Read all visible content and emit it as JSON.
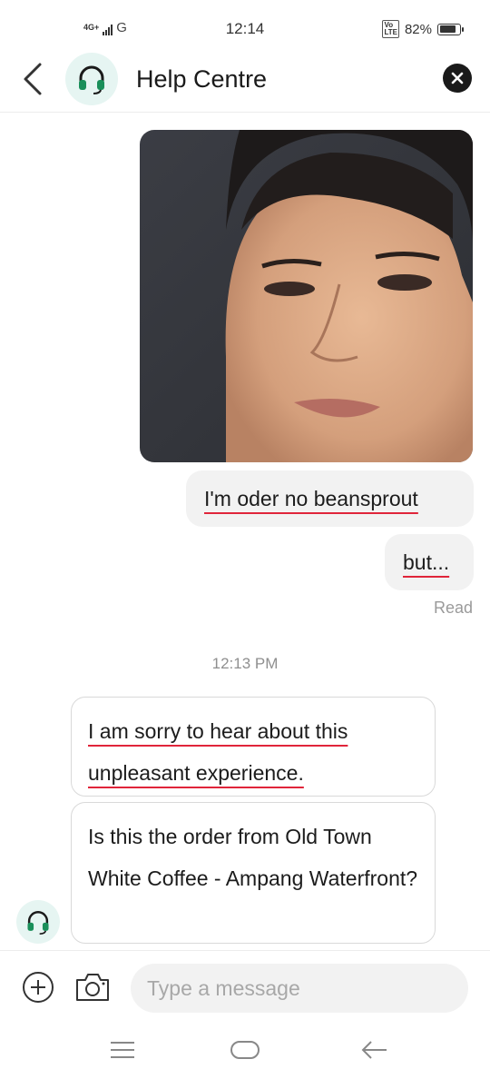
{
  "status_bar": {
    "network": "4G+",
    "carrier_icon": "G",
    "time": "12:14",
    "volte": "VoLTE",
    "battery_text": "82%",
    "battery_level": 0.82
  },
  "header": {
    "title": "Help Centre",
    "back_icon": "chevron-left-icon",
    "avatar_icon": "headset-icon",
    "close_icon": "close-icon"
  },
  "messages": {
    "outgoing": [
      {
        "type": "image",
        "description_icon": "photo-message"
      },
      {
        "type": "text",
        "text": "I'm oder no beansprout"
      },
      {
        "type": "text",
        "text": "but..."
      }
    ],
    "read_receipt": "Read",
    "timestamp": "12:13 PM",
    "incoming": [
      {
        "text": "I am sorry to hear about this unpleasant experience."
      },
      {
        "text": "Is this the order from Old Town White Coffee - Ampang Waterfront?"
      }
    ]
  },
  "composer": {
    "placeholder": "Type a message",
    "add_icon": "plus-circle-icon",
    "camera_icon": "camera-icon"
  },
  "colors": {
    "accent_green": "#1a8f5a",
    "avatar_bg": "#e6f5f2",
    "spellcheck_red": "#e0253a"
  }
}
